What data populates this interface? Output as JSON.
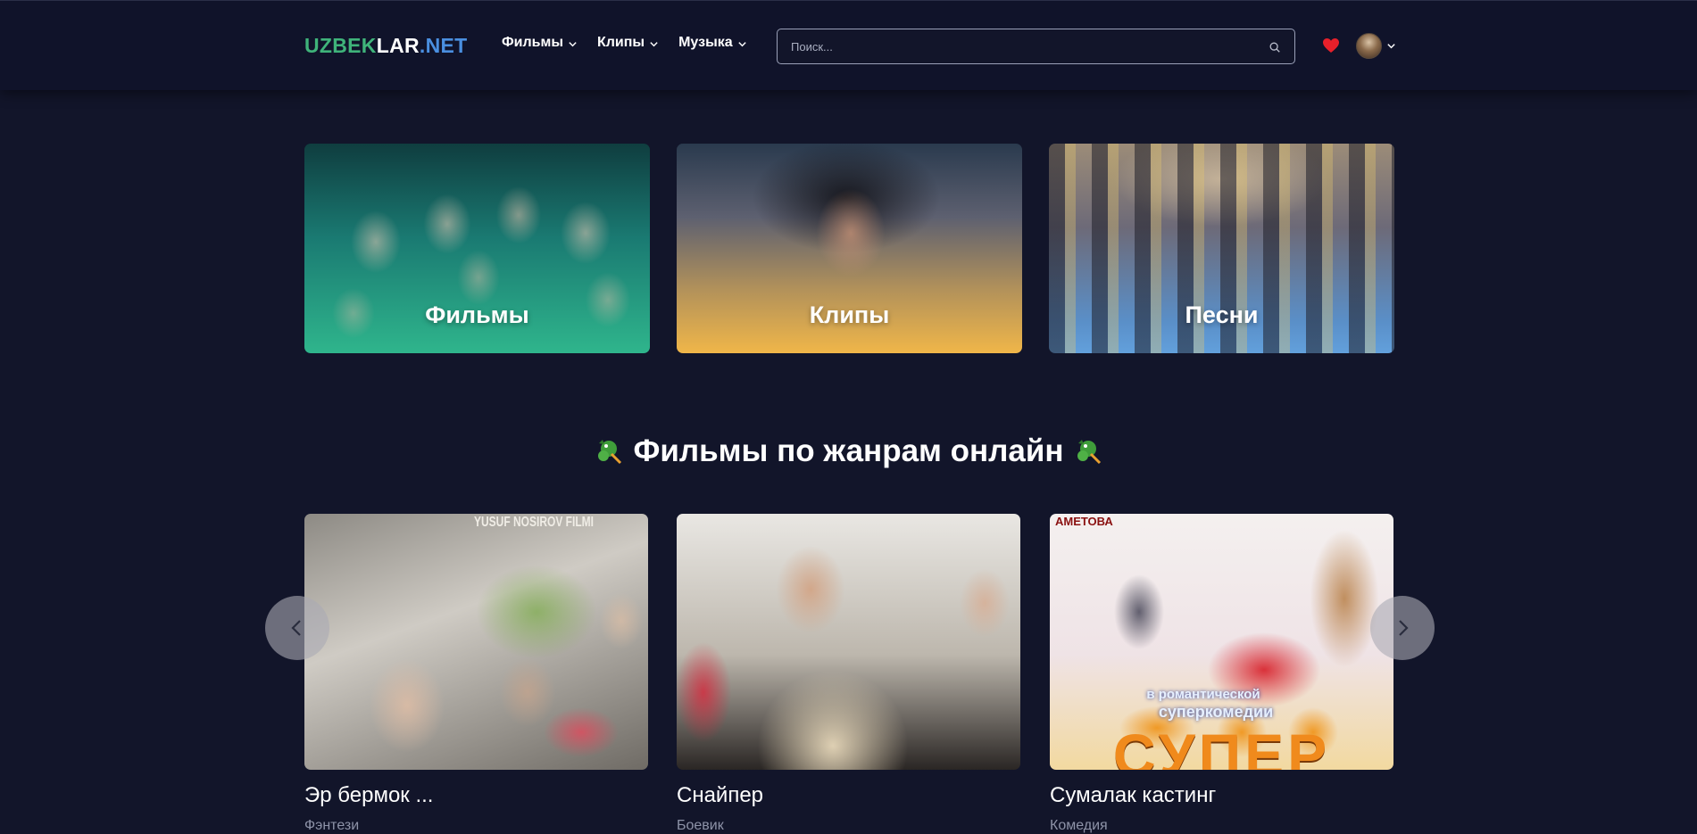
{
  "header": {
    "logo": {
      "part1": "UZBEK",
      "part2": "LAR",
      "part3": ".NET"
    },
    "nav": [
      {
        "label": "Фильмы"
      },
      {
        "label": "Клипы"
      },
      {
        "label": "Музыка"
      }
    ],
    "search": {
      "placeholder": "Поиск...",
      "value": ""
    },
    "favorites_icon": "heart-icon",
    "user_icon": "avatar"
  },
  "categories": [
    {
      "label": "Фильмы"
    },
    {
      "label": "Клипы"
    },
    {
      "label": "Песни"
    }
  ],
  "section": {
    "title": "Фильмы по жанрам онлайн"
  },
  "movies": [
    {
      "title": "Эр бермок ...",
      "genre": "Фэнтези",
      "poster_caption": "YUSUF NOSIROV FILMI"
    },
    {
      "title": "Снайпер",
      "genre": "Боевик"
    },
    {
      "title": "Сумалак кастинг",
      "genre": "Комедия",
      "poster_top_caption": "АМЕТОВА",
      "poster_caption_1": "в романтической",
      "poster_caption_2": "суперкомедии",
      "poster_caption_3": "СУПЕР"
    }
  ],
  "colors": {
    "background": "#12152a",
    "logo_green": "#3fb37a",
    "logo_blue": "#4a8fe0",
    "heart": "#e8202a",
    "genre_text": "#8e93a8"
  }
}
